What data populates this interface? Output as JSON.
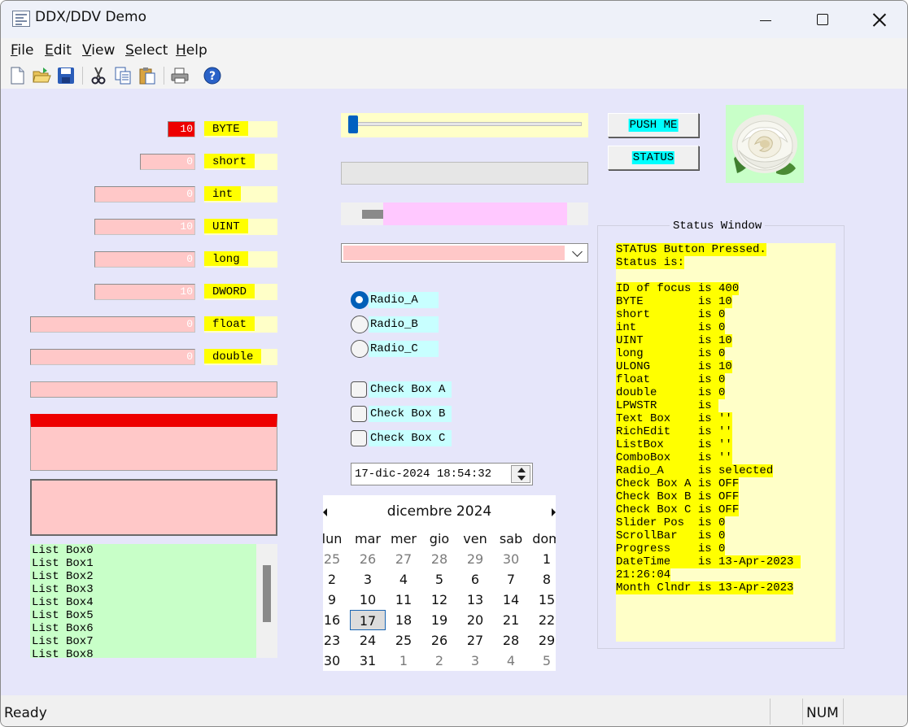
{
  "window": {
    "title": "DDX/DDV Demo"
  },
  "menu": [
    {
      "label": "File",
      "key": "F",
      "rest": "ile"
    },
    {
      "label": "Edit",
      "key": "E",
      "rest": "dit"
    },
    {
      "label": "View",
      "key": "V",
      "rest": "iew"
    },
    {
      "label": "Select",
      "key": "S",
      "rest": "elect"
    },
    {
      "label": "Help",
      "key": "H",
      "rest": "elp"
    }
  ],
  "toolbar": [
    "new-file-icon",
    "open-folder-icon",
    "save-icon",
    "cut-icon",
    "copy-icon",
    "paste-icon",
    "print-icon",
    "help-icon"
  ],
  "fields": [
    {
      "name": "byte",
      "value": "10",
      "label": "BYTE"
    },
    {
      "name": "short",
      "value": "0",
      "label": "short"
    },
    {
      "name": "int",
      "value": "0",
      "label": "int"
    },
    {
      "name": "uint",
      "value": "10",
      "label": "UINT"
    },
    {
      "name": "long",
      "value": "0",
      "label": "long"
    },
    {
      "name": "dword",
      "value": "10",
      "label": "DWORD"
    },
    {
      "name": "float",
      "value": "0",
      "label": "float"
    },
    {
      "name": "double",
      "value": "0",
      "label": "double"
    }
  ],
  "listbox": {
    "items": [
      "List Box0",
      "List Box1",
      "List Box2",
      "List Box3",
      "List Box4",
      "List Box5",
      "List Box6",
      "List Box7",
      "List Box8"
    ]
  },
  "slider": {
    "position": 0
  },
  "progress": {
    "value": 0
  },
  "radios": [
    {
      "label": "Radio_A",
      "checked": true
    },
    {
      "label": "Radio_B",
      "checked": false
    },
    {
      "label": "Radio_C",
      "checked": false
    }
  ],
  "checkboxes": [
    {
      "label": "Check Box A",
      "checked": false
    },
    {
      "label": "Check Box B",
      "checked": false
    },
    {
      "label": "Check Box C",
      "checked": false
    }
  ],
  "datetime": {
    "value": "17-dic-2024 18:54:32"
  },
  "calendar": {
    "title": "dicembre 2024",
    "weekdays": [
      "lun",
      "mar",
      "mer",
      "gio",
      "ven",
      "sab",
      "dom"
    ],
    "weeks": [
      [
        "25",
        "26",
        "27",
        "28",
        "29",
        "30",
        "1"
      ],
      [
        "2",
        "3",
        "4",
        "5",
        "6",
        "7",
        "8"
      ],
      [
        "9",
        "10",
        "11",
        "12",
        "13",
        "14",
        "15"
      ],
      [
        "16",
        "17",
        "18",
        "19",
        "20",
        "21",
        "22"
      ],
      [
        "23",
        "24",
        "25",
        "26",
        "27",
        "28",
        "29"
      ],
      [
        "30",
        "31",
        "1",
        "2",
        "3",
        "4",
        "5"
      ]
    ],
    "selected": "17"
  },
  "buttons": {
    "push_me": "PUSH ME",
    "status": "STATUS"
  },
  "image": {
    "subject": "white rose"
  },
  "status_window": {
    "title": "Status Window",
    "lines": [
      "STATUS Button Pressed.",
      "Status is:",
      "",
      "ID of focus is 400",
      "BYTE        is 10",
      "short       is 0",
      "int         is 0",
      "UINT        is 10",
      "long        is 0",
      "ULONG       is 10",
      "float       is 0",
      "double      is 0",
      "LPWSTR      is ",
      "Text Box    is ''",
      "RichEdit    is ''",
      "ListBox     is ''",
      "ComboBox    is ''",
      "Radio_A     is selected",
      "Check Box A is OFF",
      "Check Box B is OFF",
      "Check Box C is OFF",
      "Slider Pos  is 0",
      "ScrollBar   is 0",
      "Progress    is 0",
      "DateTime    is 13-Apr-2023 ",
      "21:26:04",
      "Month Clndr is 13-Apr-2023"
    ]
  },
  "statusbar": {
    "text": "Ready",
    "num": "NUM"
  },
  "colors": {
    "client_bg": "#e6e6fa",
    "edit_bg": "#ffc8c8",
    "label_yellow": "#ffff00",
    "list_green": "#c8ffc8",
    "accent": "#005fb8"
  }
}
